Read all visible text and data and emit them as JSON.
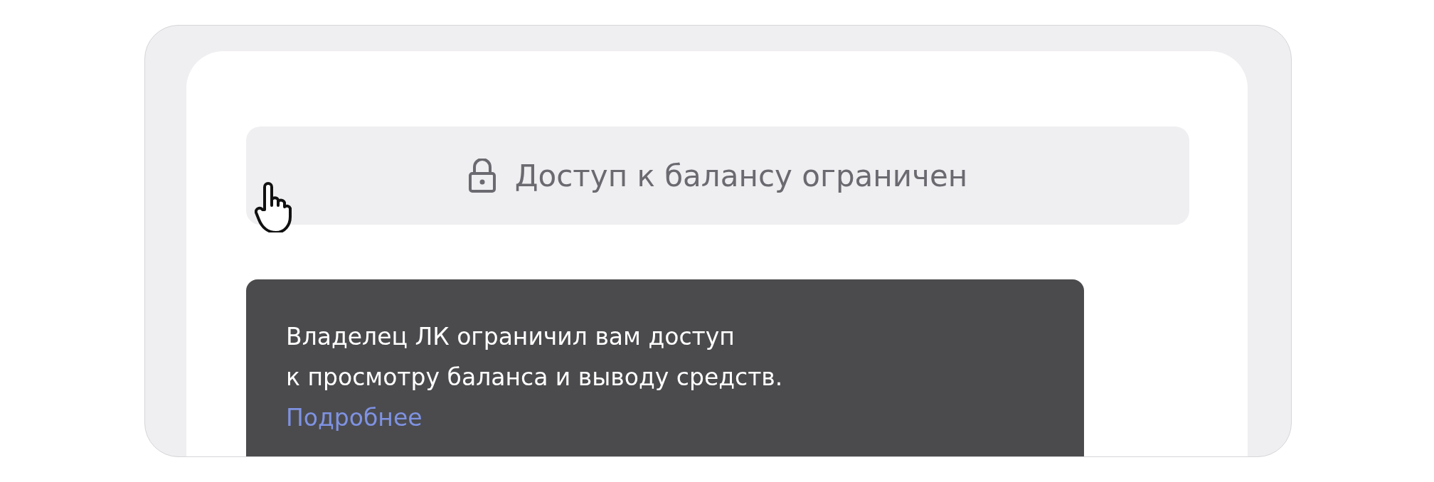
{
  "balance_button": {
    "label": "Доступ к балансу ограничен",
    "disabled": true
  },
  "tooltip": {
    "lines": [
      "Владелец ЛК ограничил вам доступ",
      "к просмотру баланса и выводу средств."
    ],
    "link": "Подробнее"
  }
}
